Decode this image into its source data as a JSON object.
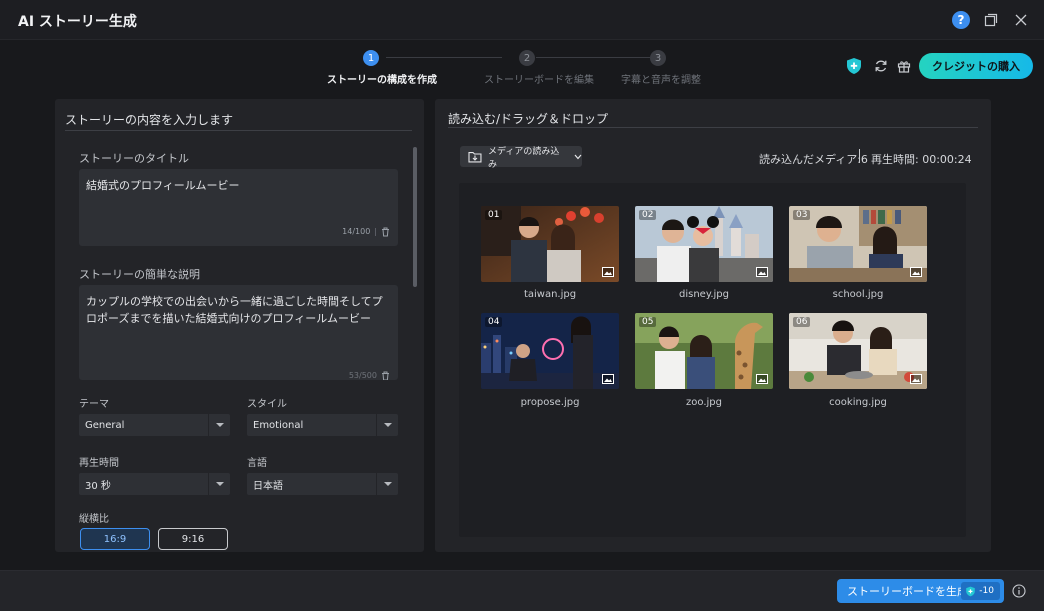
{
  "window": {
    "title": "AI ストーリー生成",
    "help_label": "?"
  },
  "stepper": {
    "steps": [
      {
        "number": "1",
        "label": "ストーリーの構成を作成",
        "active": true
      },
      {
        "number": "2",
        "label": "ストーリーボードを編集",
        "active": false
      },
      {
        "number": "3",
        "label": "字幕と音声を調整",
        "active": false
      }
    ]
  },
  "toolbar": {
    "credit_button": "クレジットの購入"
  },
  "left_panel": {
    "heading": "ストーリーの内容を入力します",
    "title_label": "ストーリーのタイトル",
    "title_value": "結婚式のプロフィールムービー",
    "title_count": "14/100",
    "description_label": "ストーリーの簡単な説明",
    "description_value": "カップルの学校での出会いから一緒に過ごした時間そしてプロポーズまでを描いた結婚式向けのプロフィールムービー",
    "theme_label": "テーマ",
    "theme_value": "General",
    "style_label": "スタイル",
    "style_value": "Emotional",
    "duration_label": "再生時間",
    "duration_value": "30 秒",
    "language_label": "言語",
    "language_value": "日本語",
    "ratio_label": "縦横比",
    "ratio_options": [
      {
        "label": "16:9",
        "selected": true
      },
      {
        "label": "9:16",
        "selected": false
      }
    ]
  },
  "right_panel": {
    "heading": "読み込む/ドラッグ＆ドロップ",
    "import_button": "メディアの読み込み",
    "media_count": "読み込んだメディア:6",
    "duration": "再生時間: 00:00:24",
    "media": [
      {
        "number": "01",
        "name": "taiwan.jpg"
      },
      {
        "number": "02",
        "name": "disney.jpg"
      },
      {
        "number": "03",
        "name": "school.jpg"
      },
      {
        "number": "04",
        "name": "propose.jpg"
      },
      {
        "number": "05",
        "name": "zoo.jpg"
      },
      {
        "number": "06",
        "name": "cooking.jpg"
      }
    ]
  },
  "footer": {
    "generate_button": "ストーリーボードを生成",
    "cost": "-10"
  },
  "colors": {
    "accent": "#2d8ce8",
    "credit_gradient_start": "#25d3c0",
    "credit_gradient_end": "#16b9e8",
    "background": "#18191c",
    "panel": "#232428"
  }
}
